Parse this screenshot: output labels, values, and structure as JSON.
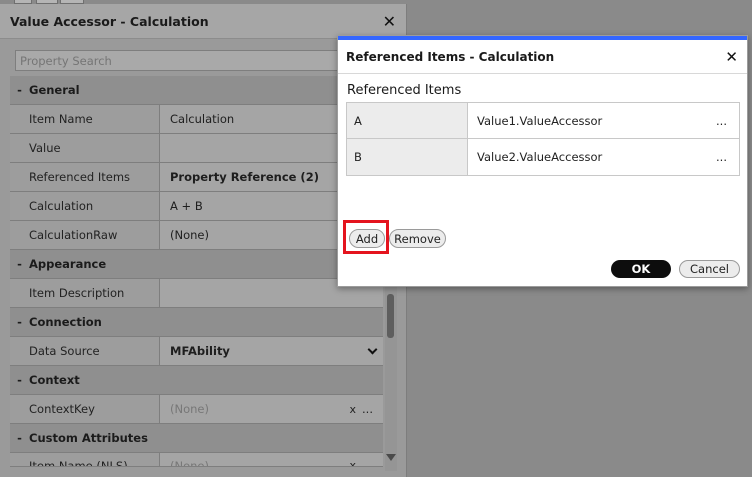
{
  "panel": {
    "title": "Value Accessor - Calculation",
    "close_glyph": "✕",
    "search_placeholder": "Property Search",
    "sections": {
      "general": {
        "label": "General",
        "collapse_glyph": "-",
        "rows": {
          "item_name": {
            "label": "Item Name",
            "value": "Calculation"
          },
          "value": {
            "label": "Value",
            "value": ""
          },
          "referenced_items": {
            "label": "Referenced Items",
            "value": "Property Reference (2)"
          },
          "calculation": {
            "label": "Calculation",
            "value": "A + B"
          },
          "calculation_raw": {
            "label": "CalculationRaw",
            "value": "(None)"
          }
        }
      },
      "appearance": {
        "label": "Appearance",
        "collapse_glyph": "-",
        "rows": {
          "item_description": {
            "label": "Item Description",
            "value": ""
          }
        }
      },
      "connection": {
        "label": "Connection",
        "collapse_glyph": "-",
        "rows": {
          "data_source": {
            "label": "Data Source",
            "value": "MFAbility"
          }
        }
      },
      "context": {
        "label": "Context",
        "collapse_glyph": "-",
        "rows": {
          "context_key": {
            "label": "ContextKey",
            "value": "(None)",
            "clear_glyph": "x",
            "more_glyph": "..."
          }
        }
      },
      "custom_attributes": {
        "label": "Custom Attributes",
        "collapse_glyph": "-",
        "rows": {
          "item_name_nls": {
            "label": "Item Name (NLS)",
            "value": "(None)",
            "clear_glyph": "x"
          }
        }
      }
    }
  },
  "dialog": {
    "title": "Referenced Items - Calculation",
    "close_glyph": "✕",
    "section_label": "Referenced Items",
    "items": [
      {
        "key": "A",
        "value": "Value1.ValueAccessor",
        "more_glyph": "..."
      },
      {
        "key": "B",
        "value": "Value2.ValueAccessor",
        "more_glyph": "..."
      }
    ],
    "add_label": "Add",
    "remove_label": "Remove",
    "ok_label": "OK",
    "cancel_label": "Cancel"
  },
  "colors": {
    "dialog_accent": "#3366ff",
    "highlight": "#e4141e",
    "ok_button": "#0d0d0d"
  }
}
